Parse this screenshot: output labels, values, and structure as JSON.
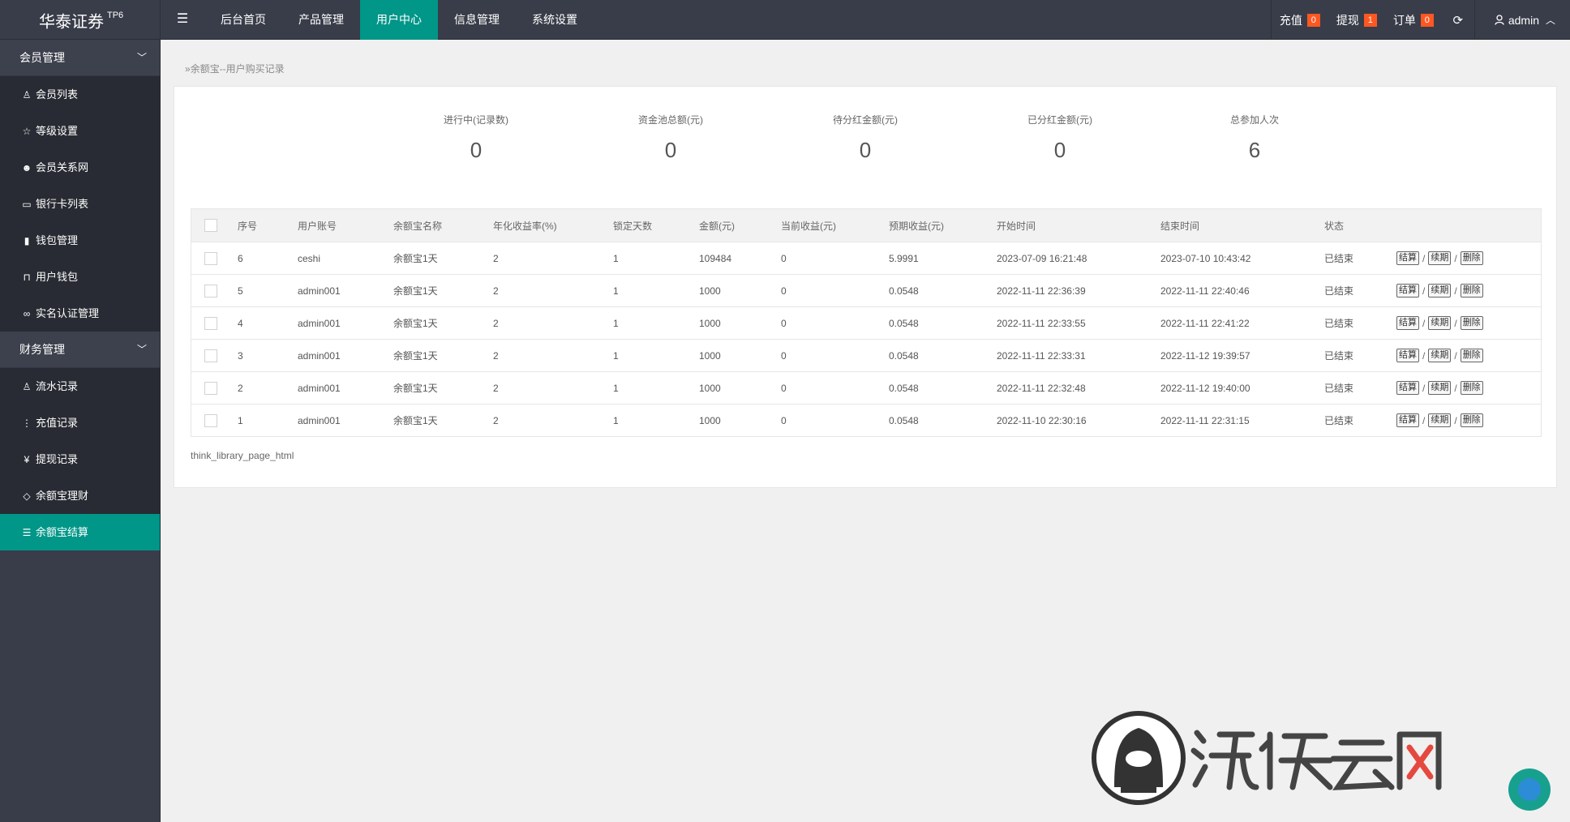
{
  "header": {
    "logo": "华泰证券",
    "logo_sup": "TP6",
    "menu_icon": "menu-icon",
    "nav": [
      "后台首页",
      "产品管理",
      "用户中心",
      "信息管理",
      "系统设置"
    ],
    "active_nav": "用户中心",
    "recharge": {
      "label": "充值",
      "count": "0"
    },
    "withdraw": {
      "label": "提现",
      "count": "1"
    },
    "orders": {
      "label": "订单",
      "count": "0"
    },
    "refresh_icon": "refresh-icon",
    "user": "admin"
  },
  "sidebar": {
    "groups": [
      {
        "label": "会员管理",
        "items": [
          {
            "icon": "user-icon",
            "label": "会员列表"
          },
          {
            "icon": "star-icon",
            "label": "等级设置"
          },
          {
            "icon": "users-icon",
            "label": "会员关系网"
          },
          {
            "icon": "card-icon",
            "label": "银行卡列表"
          },
          {
            "icon": "book-icon",
            "label": "钱包管理"
          },
          {
            "icon": "open-book-icon",
            "label": "用户钱包"
          },
          {
            "icon": "link-icon",
            "label": "实名认证管理"
          }
        ]
      },
      {
        "label": "财务管理",
        "items": [
          {
            "icon": "user-icon",
            "label": "流水记录"
          },
          {
            "icon": "more-vertical-icon",
            "label": "充值记录"
          },
          {
            "icon": "yen-icon",
            "label": "提现记录"
          },
          {
            "icon": "diamond-icon",
            "label": "余额宝理财"
          },
          {
            "icon": "list-icon",
            "label": "余额宝结算"
          }
        ]
      }
    ],
    "active_item": "余额宝结算"
  },
  "breadcrumb": "余额宝--用户购买记录",
  "stats": [
    {
      "label": "进行中(记录数)",
      "value": "0"
    },
    {
      "label": "资金池总额(元)",
      "value": "0"
    },
    {
      "label": "待分红金额(元)",
      "value": "0"
    },
    {
      "label": "已分红金额(元)",
      "value": "0"
    },
    {
      "label": "总参加人次",
      "value": "6"
    }
  ],
  "table": {
    "headers": [
      "序号",
      "用户账号",
      "余额宝名称",
      "年化收益率(%)",
      "锁定天数",
      "金额(元)",
      "当前收益(元)",
      "预期收益(元)",
      "开始时间",
      "结束时间",
      "状态"
    ],
    "actions": [
      "结算",
      "续期",
      "删除"
    ],
    "rows": [
      [
        "6",
        "ceshi",
        "余额宝1天",
        "2",
        "1",
        "109484",
        "0",
        "5.9991",
        "2023-07-09 16:21:48",
        "2023-07-10 10:43:42",
        "已结束"
      ],
      [
        "5",
        "admin001",
        "余额宝1天",
        "2",
        "1",
        "1000",
        "0",
        "0.0548",
        "2022-11-11 22:36:39",
        "2022-11-11 22:40:46",
        "已结束"
      ],
      [
        "4",
        "admin001",
        "余额宝1天",
        "2",
        "1",
        "1000",
        "0",
        "0.0548",
        "2022-11-11 22:33:55",
        "2022-11-11 22:41:22",
        "已结束"
      ],
      [
        "3",
        "admin001",
        "余额宝1天",
        "2",
        "1",
        "1000",
        "0",
        "0.0548",
        "2022-11-11 22:33:31",
        "2022-11-12 19:39:57",
        "已结束"
      ],
      [
        "2",
        "admin001",
        "余额宝1天",
        "2",
        "1",
        "1000",
        "0",
        "0.0548",
        "2022-11-11 22:32:48",
        "2022-11-12 19:40:00",
        "已结束"
      ],
      [
        "1",
        "admin001",
        "余额宝1天",
        "2",
        "1",
        "1000",
        "0",
        "0.0548",
        "2022-11-10 22:30:16",
        "2022-11-11 22:31:15",
        "已结束"
      ]
    ]
  },
  "pager_text": "think_library_page_html",
  "watermark": "游侠云码网",
  "colors": {
    "header_bg": "#393d49",
    "accent": "#009688",
    "badge": "#ff5722",
    "sidebar_item_bg": "#282b33"
  }
}
